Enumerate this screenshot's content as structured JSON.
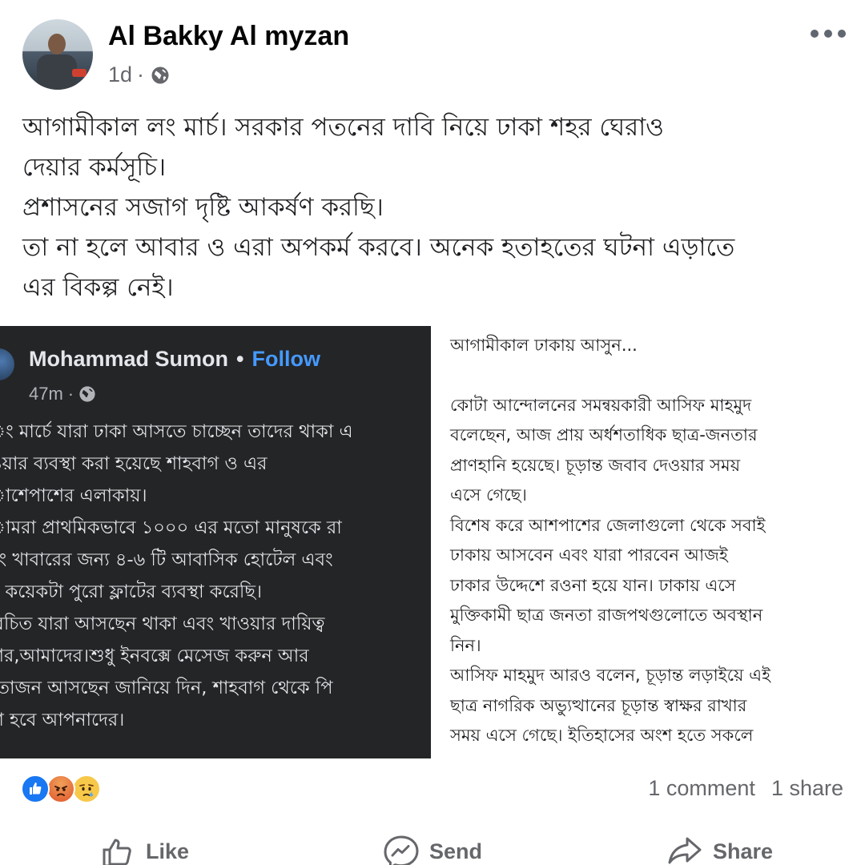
{
  "post": {
    "author": "Al Bakky Al myzan",
    "time": "1d",
    "dot": "·",
    "text_lines": [
      "আগামীকাল লং মার্চ। সরকার পতনের দাবি নিয়ে ঢাকা শহর ঘেরাও",
      "দেয়ার কর্মসূচি।",
      "প্রশাসনের সজাগ দৃষ্টি আকর্ষণ করছি।",
      "তা না হলে আবার ও এরা অপকর্ম করবে। অনেক হতাহতের ঘটনা এড়াতে",
      "এর বিকল্প নেই।"
    ]
  },
  "shared_left": {
    "name": "Mohammad Sumon",
    "separator": "•",
    "follow": "Follow",
    "time": "47m",
    "dot": "·",
    "text_lines": [
      "ং মার্চে যারা ঢাকা আসতে চাচ্ছেন তাদের থাকা এ",
      "ওয়ার ব্যবস্থা করা হয়েছে শাহবাগ ও এর",
      "াশেপাশের এলাকায়।",
      "ামরা প্রাথমিকভাবে ১০০০ এর মতো মানুষকে রা",
      "বং খাবারের জন্য ৪-৬ টি আবাসিক হোটেল এবং",
      "শ কয়েকটা পুরো ফ্লাটের ব্যবস্থা করেছি।",
      "রিচিত যারা আসছেন থাকা এবং খাওয়ার দায়িত্ব",
      "মার,আমাদের।শুধু ইনবক্সে মেসেজ করুন আর",
      "তোজন আসছেন জানিয়ে দিন, শাহবাগ থেকে পি",
      "রা হবে আপনাদের।"
    ]
  },
  "shared_right": {
    "title": "আগামীকাল ঢাকায় আসুন...",
    "text_lines": [
      "কোটা আন্দোলনের সমন্বয়কারী আসিফ মাহমুদ",
      "বলেছেন, আজ প্রায় অর্ধশতাধিক ছাত্র-জনতার",
      "প্রাণহানি হয়েছে। চূড়ান্ত জবাব দেওয়ার সময়",
      "এসে গেছে।",
      "বিশেষ করে আশপাশের জেলাগুলো থেকে সবাই",
      "ঢাকায় আসবেন এবং যারা পারবেন আজই",
      "ঢাকার উদ্দেশে রওনা হয়ে যান। ঢাকায় এসে",
      "মুক্তিকামী ছাত্র জনতা রাজপথগুলোতে অবস্থান",
      "নিন।",
      "আসিফ মাহমুদ আরও বলেন, চূড়ান্ত লড়াইয়ে এই",
      "ছাত্র নাগরিক অভ্যুত্থানের চূড়ান্ত স্বাক্ষর রাখার",
      "সময় এসে গেছে। ইতিহাসের অংশ হতে সকলে"
    ]
  },
  "footer": {
    "reactions": [
      "like",
      "angry",
      "sad"
    ],
    "comments": "1 comment",
    "shares": "1 share",
    "actions": {
      "like": "Like",
      "send": "Send",
      "share": "Share"
    }
  },
  "colors": {
    "facebook_blue": "#1877f2",
    "follow_blue": "#4599ff",
    "secondary_text": "#65676b",
    "dark_panel": "#242526"
  }
}
